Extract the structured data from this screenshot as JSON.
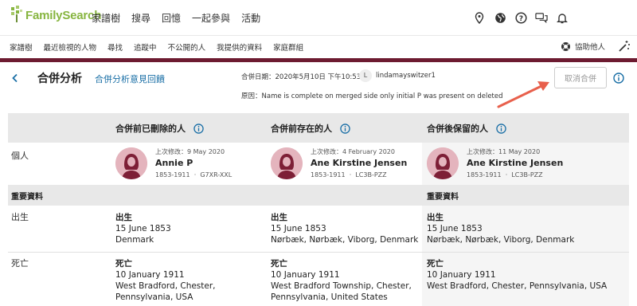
{
  "brand": {
    "logo_text": "FamilySearch",
    "brand_color": "#87b540",
    "accent_color": "#6d1b31"
  },
  "top_nav": [
    "家譜樹",
    "搜尋",
    "回憶",
    "一起參與",
    "活動"
  ],
  "top_icons": [
    "location-pin-icon",
    "globe-icon",
    "help-icon",
    "messages-icon",
    "bell-icon"
  ],
  "sub_nav": [
    "家譜樹",
    "最近檢視的人物",
    "尋找",
    "追蹤中",
    "不公開的人",
    "我提供的資料",
    "家庭群組"
  ],
  "helper_label": "協助他人",
  "header": {
    "title": "合併分析",
    "feedback_link": "合併分析意見回饋",
    "merge_date": "合併日期：2020年5月10日 下午10:53",
    "user_initial": "L",
    "username": "lindamayswitzer1",
    "reason": "原因：Name is complete on merged side only initial P was present on deleted",
    "undo_button": "取消合併"
  },
  "table": {
    "columns": [
      {
        "heading": "合併前已刪除的人"
      },
      {
        "heading": "合併前存在的人"
      },
      {
        "heading": "合併後保留的人"
      }
    ],
    "row_person_label": "個人",
    "persons": [
      {
        "modified": "上次修改：9 May 2020",
        "name": "Annie P",
        "dates": "1853-1911",
        "id": "G7XR-XXL"
      },
      {
        "modified": "上次修改：4 February 2020",
        "name": "Ane Kirstine Jensen",
        "dates": "1853-1911",
        "id": "LC3B-PZZ"
      },
      {
        "modified": "上次修改：11 May 2020",
        "name": "Ane Kirstine Jensen",
        "dates": "1853-1911",
        "id": "LC3B-PZZ"
      }
    ],
    "vital_section_label": "重要資料",
    "vital_section_label_right": "重要資料",
    "birth_label": "出生",
    "death_label": "死亡",
    "birth": [
      {
        "title": "出生",
        "date": "15 June 1853",
        "place": "Denmark"
      },
      {
        "title": "出生",
        "date": "15 June 1853",
        "place": "Nørbæk, Nørbæk, Viborg, Denmark"
      },
      {
        "title": "出生",
        "date": "15 June 1853",
        "place": "Nørbæk, Nørbæk, Viborg, Denmark"
      }
    ],
    "death": [
      {
        "title": "死亡",
        "date": "10 January 1911",
        "place1": "West Bradford, Chester,",
        "place2": "Pennsylvania, USA"
      },
      {
        "title": "死亡",
        "date": "10 January 1911",
        "place1": "West Bradford Township, Chester,",
        "place2": "Pennsylvania, United States"
      },
      {
        "title": "死亡",
        "date": "10 January 1911",
        "place1": "West Bradford, Chester, Pennsylvania, USA",
        "place2": ""
      }
    ]
  }
}
